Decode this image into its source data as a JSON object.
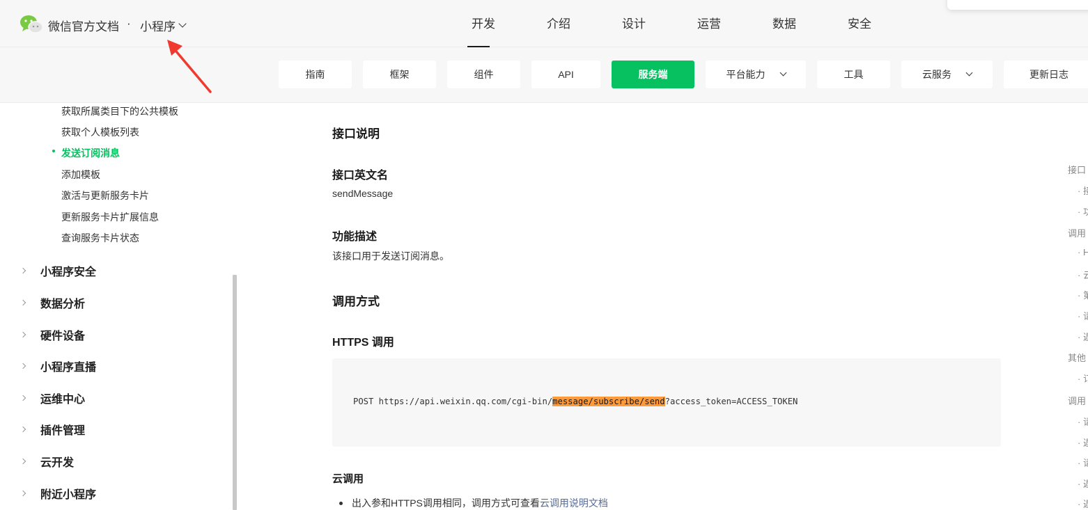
{
  "header": {
    "brand": "微信官方文档",
    "separator": "·",
    "product": "小程序",
    "nav": [
      "开发",
      "介绍",
      "设计",
      "运营",
      "数据",
      "安全"
    ],
    "active_nav": "开发"
  },
  "toolbar": {
    "items": [
      {
        "label": "指南",
        "dropdown": false
      },
      {
        "label": "框架",
        "dropdown": false
      },
      {
        "label": "组件",
        "dropdown": false
      },
      {
        "label": "API",
        "dropdown": false
      },
      {
        "label": "服务端",
        "dropdown": false,
        "active": true
      },
      {
        "label": "平台能力",
        "dropdown": true
      },
      {
        "label": "工具",
        "dropdown": false
      },
      {
        "label": "云服务",
        "dropdown": true
      },
      {
        "label": "更新日志",
        "dropdown": false
      }
    ],
    "accent_color": "#07c160"
  },
  "sidebar": {
    "sub_items": [
      {
        "label": "获取所属类目下的公共模板"
      },
      {
        "label": "获取个人模板列表"
      },
      {
        "label": "发送订阅消息",
        "active": true
      },
      {
        "label": "添加模板"
      },
      {
        "label": "激活与更新服务卡片"
      },
      {
        "label": "更新服务卡片扩展信息"
      },
      {
        "label": "查询服务卡片状态"
      }
    ],
    "sections": [
      "小程序安全",
      "数据分析",
      "硬件设备",
      "小程序直播",
      "运维中心",
      "插件管理",
      "云开发",
      "附近小程序"
    ]
  },
  "content": {
    "h_interface": "接口说明",
    "h_english_name": "接口英文名",
    "english_name": "sendMessage",
    "h_function": "功能描述",
    "function_desc": "该接口用于发送订阅消息。",
    "h_call": "调用方式",
    "h_https": "HTTPS 调用",
    "code_prefix": "POST https://api.weixin.qq.com/cgi-bin/",
    "code_highlight": "message/subscribe/send",
    "code_suffix": "?access_token=ACCESS_TOKEN",
    "h_cloud": "云调用",
    "bullet_text": "出入参和HTTPS调用相同，调用方式可查看",
    "bullet_link": "云调用说明文档"
  },
  "toc": {
    "items": [
      "接口",
      "· 接",
      "· 功",
      "调用",
      "· H",
      "· 云",
      "· 第",
      "· 请",
      "· 返",
      "其他",
      "· 订",
      "调用",
      "· 请",
      "· 返",
      "· 请",
      "· 返",
      "· 返"
    ]
  },
  "annotation": {
    "arrow_color": "#f03a2e"
  }
}
